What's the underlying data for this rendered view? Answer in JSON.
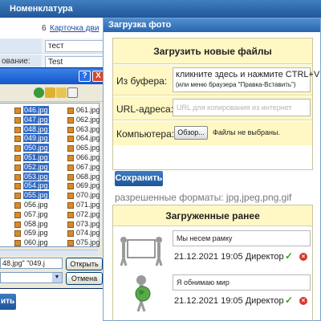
{
  "header": {
    "title": "Номенклатура"
  },
  "background_form": {
    "number": "6",
    "link": "Карточка дви",
    "field_1": "тест",
    "label_2": "ование:",
    "field_2": "Test",
    "bottom_button": "ить"
  },
  "file_dialog": {
    "help_button": "?",
    "close_button": "X",
    "column_1": [
      "046.jpg",
      "047.jpg",
      "048.jpg",
      "049.jpg",
      "050.jpg",
      "051.jpg",
      "052.jpg",
      "053.jpg",
      "054.jpg",
      "055.jpg",
      "056.jpg",
      "057.jpg",
      "058.jpg",
      "059.jpg",
      "060.jpg"
    ],
    "column_2": [
      "061.jpg",
      "062.jpg",
      "063.jpg",
      "064.jpg",
      "065.jpg",
      "066.jpg",
      "067.jpg",
      "068.jpg",
      "069.jpg",
      "070.jpg",
      "071.jpg",
      "072.jpg",
      "073.jpg",
      "074.jpg",
      "075.jpg"
    ],
    "selected_count": 10,
    "filename_value": "48.jpg\" \"049.j",
    "open_button": "Открыть",
    "cancel_button": "Отмена"
  },
  "panel": {
    "title": "Загрузка фото",
    "upload": {
      "heading": "Загрузить новые файлы",
      "clipboard_label": "Из буфера:",
      "clipboard_text": "кликните здесь и нажмите CTRL+V",
      "clipboard_hint": "(или меню браузера \"Правка-Вставить\")",
      "url_label": "URL-адреса:",
      "url_placeholder": "URL для копирования из интернет",
      "computer_label": "Компьютера:",
      "browse_button": "Обзор...",
      "no_files": "Файлы не выбраны.",
      "save_button": "Сохранить",
      "formats": "разрешенные форматы: jpg,jpeg,png,gif"
    },
    "uploaded": {
      "heading": "Загруженные ранее",
      "items": [
        {
          "caption": "Мы несем рамку",
          "meta": "21.12.2021 19:05 Директор",
          "check_icon": "✓",
          "delete_icon": "×"
        },
        {
          "caption": "Я обнимаю мир",
          "meta": "21.12.2021 19:05 Директор",
          "check_icon": "✓",
          "delete_icon": "×"
        }
      ]
    }
  },
  "colors": {
    "header_blue": "#2a66ad",
    "selection_blue": "#316ac5",
    "box_yellow": "#fff8c4",
    "check_green": "#3aa02b",
    "delete_red": "#d33a2c"
  }
}
